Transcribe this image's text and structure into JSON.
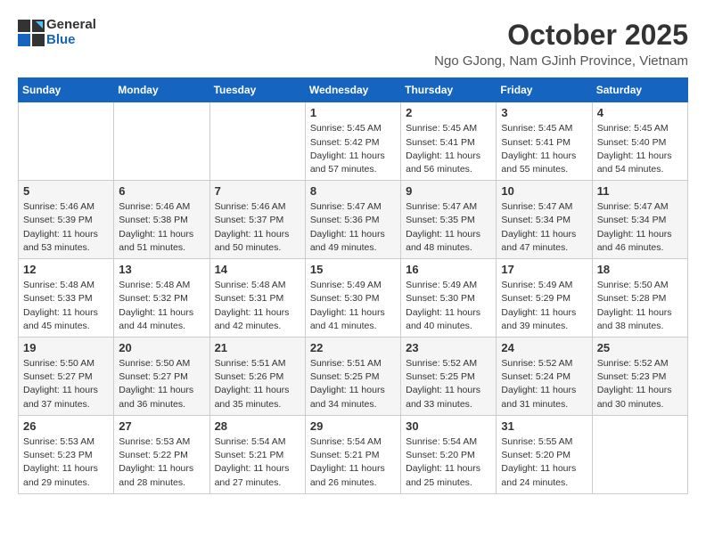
{
  "header": {
    "logo_general": "General",
    "logo_blue": "Blue",
    "title": "October 2025",
    "subtitle": "Ngo GJong, Nam GJinh Province, Vietnam"
  },
  "weekdays": [
    "Sunday",
    "Monday",
    "Tuesday",
    "Wednesday",
    "Thursday",
    "Friday",
    "Saturday"
  ],
  "weeks": [
    [
      {
        "day": "",
        "info": ""
      },
      {
        "day": "",
        "info": ""
      },
      {
        "day": "",
        "info": ""
      },
      {
        "day": "1",
        "info": "Sunrise: 5:45 AM\nSunset: 5:42 PM\nDaylight: 11 hours\nand 57 minutes."
      },
      {
        "day": "2",
        "info": "Sunrise: 5:45 AM\nSunset: 5:41 PM\nDaylight: 11 hours\nand 56 minutes."
      },
      {
        "day": "3",
        "info": "Sunrise: 5:45 AM\nSunset: 5:41 PM\nDaylight: 11 hours\nand 55 minutes."
      },
      {
        "day": "4",
        "info": "Sunrise: 5:45 AM\nSunset: 5:40 PM\nDaylight: 11 hours\nand 54 minutes."
      }
    ],
    [
      {
        "day": "5",
        "info": "Sunrise: 5:46 AM\nSunset: 5:39 PM\nDaylight: 11 hours\nand 53 minutes."
      },
      {
        "day": "6",
        "info": "Sunrise: 5:46 AM\nSunset: 5:38 PM\nDaylight: 11 hours\nand 51 minutes."
      },
      {
        "day": "7",
        "info": "Sunrise: 5:46 AM\nSunset: 5:37 PM\nDaylight: 11 hours\nand 50 minutes."
      },
      {
        "day": "8",
        "info": "Sunrise: 5:47 AM\nSunset: 5:36 PM\nDaylight: 11 hours\nand 49 minutes."
      },
      {
        "day": "9",
        "info": "Sunrise: 5:47 AM\nSunset: 5:35 PM\nDaylight: 11 hours\nand 48 minutes."
      },
      {
        "day": "10",
        "info": "Sunrise: 5:47 AM\nSunset: 5:34 PM\nDaylight: 11 hours\nand 47 minutes."
      },
      {
        "day": "11",
        "info": "Sunrise: 5:47 AM\nSunset: 5:34 PM\nDaylight: 11 hours\nand 46 minutes."
      }
    ],
    [
      {
        "day": "12",
        "info": "Sunrise: 5:48 AM\nSunset: 5:33 PM\nDaylight: 11 hours\nand 45 minutes."
      },
      {
        "day": "13",
        "info": "Sunrise: 5:48 AM\nSunset: 5:32 PM\nDaylight: 11 hours\nand 44 minutes."
      },
      {
        "day": "14",
        "info": "Sunrise: 5:48 AM\nSunset: 5:31 PM\nDaylight: 11 hours\nand 42 minutes."
      },
      {
        "day": "15",
        "info": "Sunrise: 5:49 AM\nSunset: 5:30 PM\nDaylight: 11 hours\nand 41 minutes."
      },
      {
        "day": "16",
        "info": "Sunrise: 5:49 AM\nSunset: 5:30 PM\nDaylight: 11 hours\nand 40 minutes."
      },
      {
        "day": "17",
        "info": "Sunrise: 5:49 AM\nSunset: 5:29 PM\nDaylight: 11 hours\nand 39 minutes."
      },
      {
        "day": "18",
        "info": "Sunrise: 5:50 AM\nSunset: 5:28 PM\nDaylight: 11 hours\nand 38 minutes."
      }
    ],
    [
      {
        "day": "19",
        "info": "Sunrise: 5:50 AM\nSunset: 5:27 PM\nDaylight: 11 hours\nand 37 minutes."
      },
      {
        "day": "20",
        "info": "Sunrise: 5:50 AM\nSunset: 5:27 PM\nDaylight: 11 hours\nand 36 minutes."
      },
      {
        "day": "21",
        "info": "Sunrise: 5:51 AM\nSunset: 5:26 PM\nDaylight: 11 hours\nand 35 minutes."
      },
      {
        "day": "22",
        "info": "Sunrise: 5:51 AM\nSunset: 5:25 PM\nDaylight: 11 hours\nand 34 minutes."
      },
      {
        "day": "23",
        "info": "Sunrise: 5:52 AM\nSunset: 5:25 PM\nDaylight: 11 hours\nand 33 minutes."
      },
      {
        "day": "24",
        "info": "Sunrise: 5:52 AM\nSunset: 5:24 PM\nDaylight: 11 hours\nand 31 minutes."
      },
      {
        "day": "25",
        "info": "Sunrise: 5:52 AM\nSunset: 5:23 PM\nDaylight: 11 hours\nand 30 minutes."
      }
    ],
    [
      {
        "day": "26",
        "info": "Sunrise: 5:53 AM\nSunset: 5:23 PM\nDaylight: 11 hours\nand 29 minutes."
      },
      {
        "day": "27",
        "info": "Sunrise: 5:53 AM\nSunset: 5:22 PM\nDaylight: 11 hours\nand 28 minutes."
      },
      {
        "day": "28",
        "info": "Sunrise: 5:54 AM\nSunset: 5:21 PM\nDaylight: 11 hours\nand 27 minutes."
      },
      {
        "day": "29",
        "info": "Sunrise: 5:54 AM\nSunset: 5:21 PM\nDaylight: 11 hours\nand 26 minutes."
      },
      {
        "day": "30",
        "info": "Sunrise: 5:54 AM\nSunset: 5:20 PM\nDaylight: 11 hours\nand 25 minutes."
      },
      {
        "day": "31",
        "info": "Sunrise: 5:55 AM\nSunset: 5:20 PM\nDaylight: 11 hours\nand 24 minutes."
      },
      {
        "day": "",
        "info": ""
      }
    ]
  ]
}
